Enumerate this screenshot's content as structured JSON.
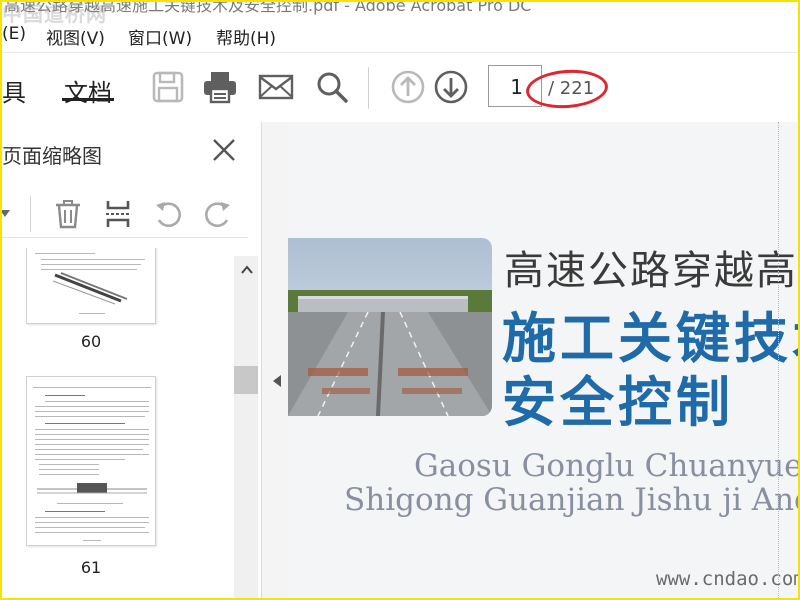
{
  "window": {
    "title": "高速公路穿越高速施工关键技术及安全控制.pdf - Adobe Acrobat Pro DC",
    "watermark": "中国道桥网"
  },
  "menu": {
    "items": [
      {
        "label": "(E)"
      },
      {
        "label": "视图(V)"
      },
      {
        "label": "窗口(W)"
      },
      {
        "label": "帮助(H)"
      }
    ]
  },
  "toolbar": {
    "tab_tools": "具",
    "tab_document": "文档",
    "icons": [
      "save-icon",
      "print-icon",
      "email-icon",
      "search-icon",
      "prev-page-icon",
      "next-page-icon"
    ],
    "page_current": "1",
    "page_total": "/ 221",
    "highlight_color": "#e0262e"
  },
  "sidepanel": {
    "title": "页面缩略图",
    "tools": [
      "dropdown-icon",
      "delete-icon",
      "crop-icon",
      "rotate-left-icon",
      "rotate-right-icon"
    ],
    "thumbnails": [
      {
        "page_label": "60"
      },
      {
        "page_label": "61"
      }
    ]
  },
  "document": {
    "title_line1": "高速公路穿越高速",
    "title_line2": "施工关键技术",
    "title_line3": "安全控制",
    "pinyin_line1": "Gaosu Gonglu Chuanyue Ga",
    "pinyin_line2": "Shigong Guanjian Jishu ji Anquan",
    "watermark_url": "www.cndao.com",
    "accent_color": "#1f6aa8"
  }
}
